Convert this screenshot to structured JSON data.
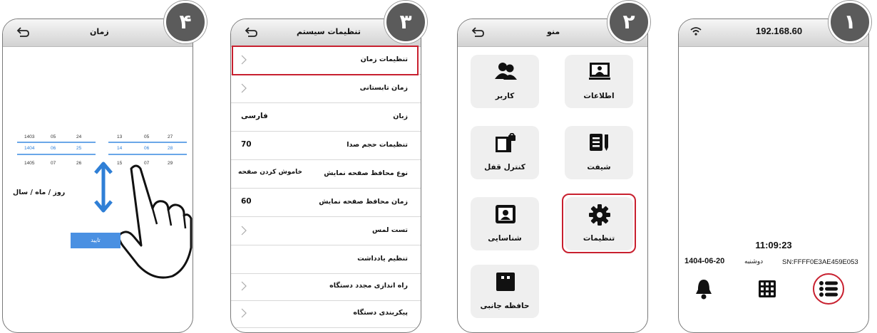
{
  "steps": [
    "۱",
    "۲",
    "۳",
    "۴"
  ],
  "screen1": {
    "ip": "192.168.60",
    "time": "11:09:23",
    "sn": "SN:FFFF0E3AE459E053",
    "date_day": "دوشنبه",
    "date": "1404-06-20"
  },
  "screen2": {
    "title": "منو",
    "tiles": [
      "اطلاعات",
      "کاربر",
      "شیفت",
      "کنترل قفل",
      "تنظیمات",
      "شناسایی",
      "حافظه جانبی"
    ]
  },
  "screen3": {
    "title": "تنظیمات سیستم",
    "rows": [
      {
        "label": "تنظیمات زمان",
        "value": ""
      },
      {
        "label": "زمان تابستانی",
        "value": ""
      },
      {
        "label": "زبان",
        "value": "فارسی"
      },
      {
        "label": "تنظیمات حجم صدا",
        "value": "70"
      },
      {
        "label": "نوع محافظ صفحه نمایش",
        "value": "خاموش کردن صفحه"
      },
      {
        "label": "زمان محافظ صفحه نمایش",
        "value": "60"
      },
      {
        "label": "تست لمس",
        "value": ""
      },
      {
        "label": "تنظیم یادداشت",
        "value": ""
      },
      {
        "label": "راه اندازی مجدد دستگاه",
        "value": ""
      },
      {
        "label": "پیکربندی دستگاه",
        "value": ""
      }
    ]
  },
  "screen4": {
    "title": "زمان",
    "date_col1": [
      "1403",
      "1404",
      "1405"
    ],
    "date_col2": [
      "05",
      "06",
      "07"
    ],
    "date_col3": [
      "24",
      "25",
      "26"
    ],
    "time_col1": [
      "13",
      "14",
      "15"
    ],
    "time_col2": [
      "05",
      "06",
      "07"
    ],
    "time_col3": [
      "27",
      "28",
      "29"
    ],
    "format": "روز / ماه / سال",
    "confirm": "تایید"
  },
  "colors": {
    "highlight": "#c8202f",
    "badge": "#5b5b5b",
    "picker": "#4a90e2"
  }
}
